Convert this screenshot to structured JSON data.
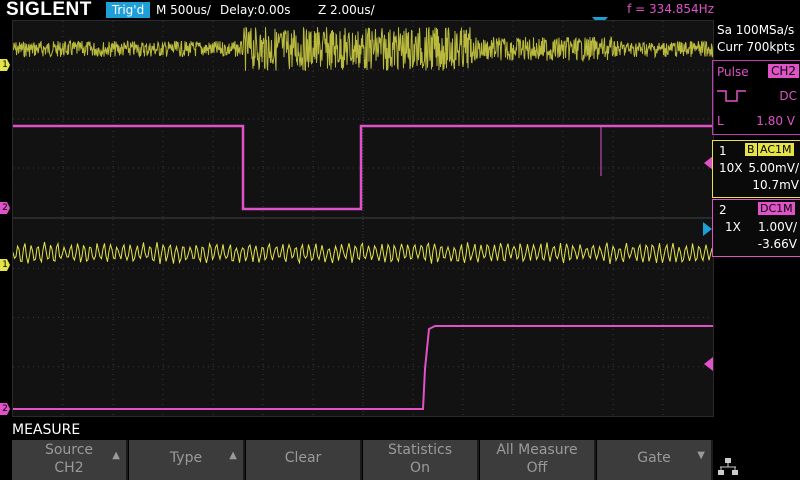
{
  "header": {
    "brand": "SIGLENT",
    "trigger_status": "Trig'd",
    "timebase": "M 500us/",
    "delay": "Delay:0.00s",
    "zoom": "Z 2.00us/",
    "frequency": "f = 334.854Hz"
  },
  "acquisition": {
    "sample_rate": "Sa 100MSa/s",
    "memory": "Curr 700kpts"
  },
  "trigger_panel": {
    "type": "Pulse",
    "source": "CH2",
    "coupling": "DC",
    "level_label": "L",
    "level": "1.80 V"
  },
  "channels": [
    {
      "num": "1",
      "bw": "B",
      "coupling": "AC1M",
      "probe": "10X",
      "scale": "5.00mV/",
      "offset": "10.7mV",
      "color": "#e4e44a"
    },
    {
      "num": "2",
      "coupling": "DC1M",
      "probe": "1X",
      "scale": "1.00V/",
      "offset": "-3.66V",
      "color": "#e052c8"
    }
  ],
  "ground_markers": {
    "ch1": "1",
    "ch2": "2"
  },
  "measure_menu": {
    "title": "MEASURE",
    "source_label": "Source",
    "source_value": "CH2",
    "type_label": "Type",
    "clear_label": "Clear",
    "statistics_label": "Statistics",
    "statistics_value": "On",
    "all_measure_label": "All Measure",
    "all_measure_value": "Off",
    "gate_label": "Gate"
  },
  "colors": {
    "ch1": "#e4e44a",
    "ch2": "#e052c8",
    "accent": "#1e9fd8"
  }
}
